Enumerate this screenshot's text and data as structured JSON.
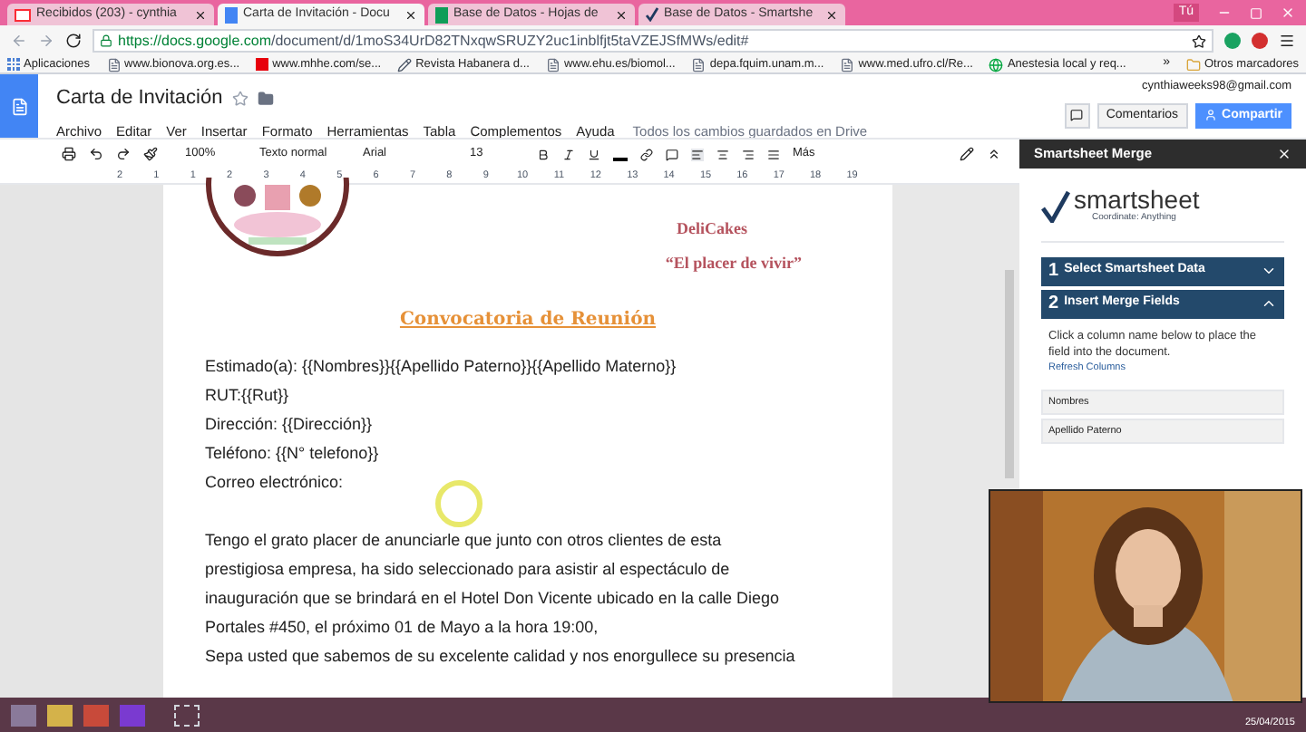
{
  "browser": {
    "tabs": [
      {
        "label": "Recibidos (203) - cynthia",
        "kind": "mail",
        "selected": false
      },
      {
        "label": "Carta de Invitación - Docu",
        "kind": "doc",
        "selected": true
      },
      {
        "label": "Base de Datos - Hojas de",
        "kind": "sheet",
        "selected": false
      },
      {
        "label": "Base de Datos - Smartshe",
        "kind": "check",
        "selected": false
      }
    ],
    "profile": "Tú",
    "url_host": "https://docs.google.com",
    "url_path": "/document/d/1moS34UrD82TNxqwSRUZY2uc1inblfjt5taVZEJSfMWs/edit#",
    "bookmarks": [
      {
        "label": "Aplicaciones",
        "kind": "apps"
      },
      {
        "label": "www.bionova.org.es...",
        "kind": "page"
      },
      {
        "label": "www.mhhe.com/se...",
        "kind": "m"
      },
      {
        "label": "Revista Habanera d...",
        "kind": "quill"
      },
      {
        "label": "www.ehu.es/biomol...",
        "kind": "page"
      },
      {
        "label": "depa.fquim.unam.m...",
        "kind": "page"
      },
      {
        "label": "www.med.ufro.cl/Re...",
        "kind": "page"
      },
      {
        "label": "Anestesia local y req...",
        "kind": "globe"
      }
    ],
    "more_bookmarks": "»",
    "other_bookmarks": "Otros marcadores"
  },
  "docs": {
    "title": "Carta de Invitación",
    "account": "cynthiaweeks98@gmail.com",
    "menu": [
      "Archivo",
      "Editar",
      "Ver",
      "Insertar",
      "Formato",
      "Herramientas",
      "Tabla",
      "Complementos",
      "Ayuda"
    ],
    "save_status": "Todos los cambios guardados en Drive",
    "comments_button": "Comentarios",
    "share_button": "Compartir",
    "toolbar": {
      "zoom": "100%",
      "style": "Texto normal",
      "font": "Arial",
      "size": "13",
      "more": "Más"
    },
    "ruler": [
      "2",
      "1",
      "1",
      "2",
      "3",
      "4",
      "5",
      "6",
      "7",
      "8",
      "9",
      "10",
      "11",
      "12",
      "13",
      "14",
      "15",
      "16",
      "17",
      "18",
      "19"
    ]
  },
  "document": {
    "company": "DeliCakes",
    "slogan": "“El placer de vivir”",
    "heading": "Convocatoria de Reunión",
    "fields": [
      "Estimado(a): {{Nombres}}{{Apellido Paterno}}{{Apellido Materno}}",
      "RUT:{{Rut}}",
      "Dirección: {{Dirección}}",
      "Teléfono: {{N° telefono}}",
      "Correo electrónico:"
    ],
    "paragraph": [
      "Tengo el grato placer de anunciarle que junto con otros clientes de esta",
      "prestigiosa empresa, ha sido seleccionado para asistir al espectáculo de",
      "inauguración que se brindará en el Hotel Don Vicente ubicado en la calle Diego",
      "Portales #450, el próximo 01 de Mayo a la hora 19:00,",
      "Sepa usted que sabemos de su excelente calidad y nos enorgullece su presencia"
    ]
  },
  "sidebar": {
    "title": "Smartsheet Merge",
    "logo": "smartsheet",
    "tagline": "Coordinate: Anything",
    "steps": [
      {
        "number": "1",
        "label": "Select Smartsheet Data",
        "expanded": false
      },
      {
        "number": "2",
        "label": "Insert Merge Fields",
        "expanded": true
      }
    ],
    "instruction": "Click a column name below to place the field into the document.",
    "refresh_link": "Refresh Columns",
    "columns": [
      "Nombres",
      "Apellido Paterno"
    ]
  },
  "taskbar": {
    "date": "25/04/2015"
  }
}
